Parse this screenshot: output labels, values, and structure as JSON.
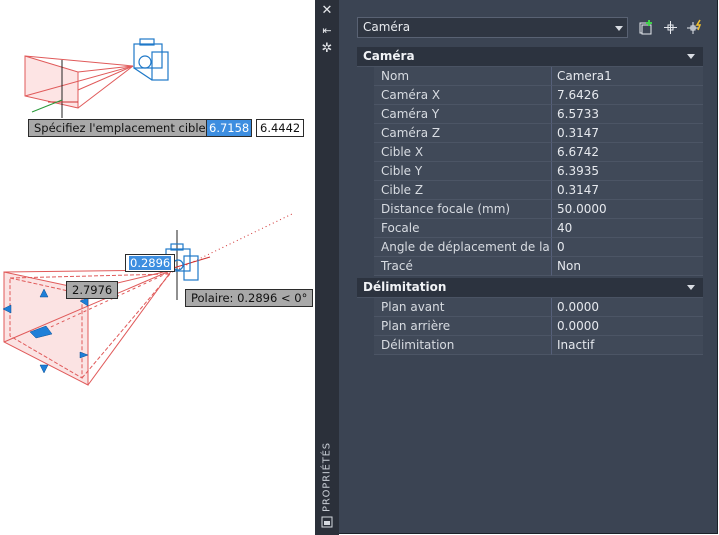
{
  "drawing": {
    "prompt_top": {
      "label": "Spécifiez l'emplacement cible:",
      "value_active": "6.7158",
      "value_next": "6.4442"
    },
    "dim_active": "0.2896",
    "dim_second": "2.7976",
    "polar_tooltip": "Polaire: 0.2896 < 0°"
  },
  "palette": {
    "vertical_title": "PROPRIÉTÉS",
    "selector_value": "Caméra",
    "toolbar": [
      "add-selection-icon",
      "select-objects-icon",
      "quick-select-icon"
    ],
    "sections": [
      {
        "title": "Caméra",
        "rows": [
          {
            "label": "Nom",
            "value": "Camera1"
          },
          {
            "label": "Caméra X",
            "value": "7.6426"
          },
          {
            "label": "Caméra Y",
            "value": "6.5733"
          },
          {
            "label": "Caméra Z",
            "value": "0.3147"
          },
          {
            "label": "Cible X",
            "value": "6.6742"
          },
          {
            "label": "Cible Y",
            "value": "6.3935"
          },
          {
            "label": "Cible Z",
            "value": "0.3147"
          },
          {
            "label": "Distance focale (mm)",
            "value": "50.0000"
          },
          {
            "label": "Focale",
            "value": "40"
          },
          {
            "label": "Angle de déplacement de la vue",
            "value": "0"
          },
          {
            "label": "Tracé",
            "value": "Non"
          }
        ]
      },
      {
        "title": "Délimitation",
        "rows": [
          {
            "label": "Plan avant",
            "value": "0.0000"
          },
          {
            "label": "Plan arrière",
            "value": "0.0000"
          },
          {
            "label": "Délimitation",
            "value": "Inactif"
          }
        ]
      }
    ]
  },
  "colors": {
    "accent": "#3d8ee0",
    "frustum": "#e05a5a",
    "camera_glyph": "#1e78c8",
    "panel": "#3b4453"
  }
}
